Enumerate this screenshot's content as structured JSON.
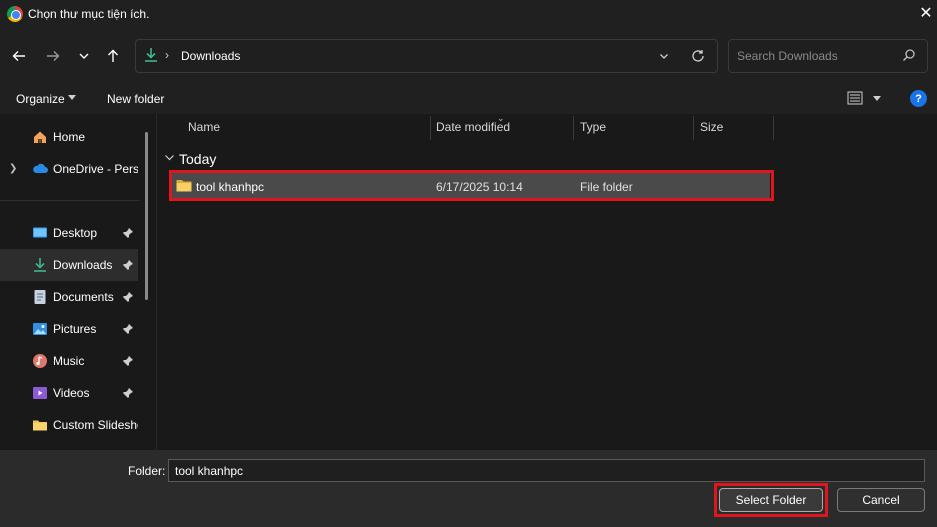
{
  "window": {
    "title": "Chọn thư mục tiện ích."
  },
  "address_bar": {
    "location": "Downloads"
  },
  "search": {
    "placeholder": "Search Downloads"
  },
  "toolbar": {
    "organize_label": "Organize",
    "new_folder_label": "New folder"
  },
  "sidebar": {
    "items": [
      {
        "label": "Home",
        "icon": "home-icon",
        "pinned": false
      },
      {
        "label": "OneDrive - Personal",
        "icon": "cloud-icon",
        "pinned": false,
        "expandable": true
      },
      {
        "label": "Desktop",
        "icon": "desktop-icon",
        "pinned": true
      },
      {
        "label": "Downloads",
        "icon": "download-icon",
        "pinned": true,
        "selected": true
      },
      {
        "label": "Documents",
        "icon": "document-icon",
        "pinned": true
      },
      {
        "label": "Pictures",
        "icon": "picture-icon",
        "pinned": true
      },
      {
        "label": "Music",
        "icon": "music-icon",
        "pinned": true
      },
      {
        "label": "Videos",
        "icon": "video-icon",
        "pinned": true
      },
      {
        "label": "Custom Slideshow",
        "icon": "folder-icon",
        "pinned": false
      }
    ]
  },
  "file_list": {
    "columns": [
      "Name",
      "Date modified",
      "Type",
      "Size"
    ],
    "group": "Today",
    "rows": [
      {
        "name": "tool khanhpc",
        "date": "6/17/2025 10:14",
        "type": "File folder",
        "size": "",
        "selected": true
      }
    ]
  },
  "footer": {
    "folder_label": "Folder:",
    "folder_value": "tool khanhpc",
    "select_button": "Select Folder",
    "cancel_button": "Cancel"
  },
  "colors": {
    "highlight_outline": "#e0161e",
    "accent_download": "#3fb68b",
    "folder_yellow": "#f2c14e",
    "help_blue": "#1a73e8"
  }
}
